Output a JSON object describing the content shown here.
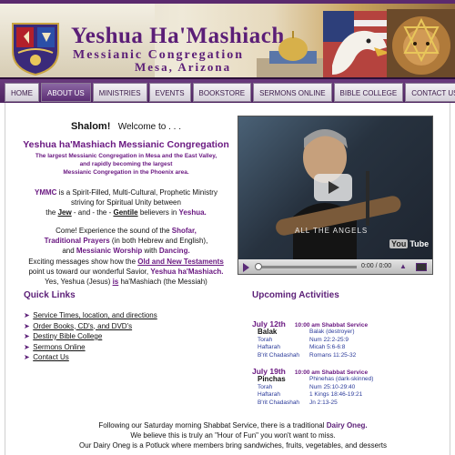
{
  "header": {
    "title_line1": "Yeshua Ha'Mashiach",
    "title_line2": "Messianic Congregation",
    "title_line3": "Mesa, Arizona"
  },
  "nav": {
    "items": [
      {
        "label": "HOME",
        "active": false
      },
      {
        "label": "ABOUT US",
        "active": true
      },
      {
        "label": "MINISTRIES",
        "active": false
      },
      {
        "label": "EVENTS",
        "active": false
      },
      {
        "label": "BOOKSTORE",
        "active": false
      },
      {
        "label": "SERMONS ONLINE",
        "active": false
      },
      {
        "label": "BIBLE COLLEGE",
        "active": false
      },
      {
        "label": "CONTACT US",
        "active": false
      }
    ]
  },
  "intro": {
    "shalom": "Shalom!",
    "welcome": "Welcome to . . .",
    "congregation": "Yeshua ha'Mashiach Messianic Congregation",
    "tagline1": "The largest Messianic Congregation in Mesa and the East Valley,",
    "tagline2": "and rapidly becoming the largest",
    "tagline3": "Messianic Congregation in the Phoenix area.",
    "ymmc_abbr": "YMMC",
    "ymmc_text1": " is a Spirit-Filled, Multi-Cultural, Prophetic Ministry",
    "ymmc_text2": "striving for Spiritual Unity between",
    "the1": "the ",
    "jew": "Jew",
    "and_the": " - and - the - ",
    "gentile": "Gentile",
    "believers_in": " believers in ",
    "yeshua": "Yeshua.",
    "come1": "Come!  Experience the sound of the ",
    "shofar": "Shofar,",
    "traditional_prayers": "Traditional Prayers",
    "come2": " (in both Hebrew and English),",
    "and1": "and ",
    "messianic_worship": "Messianic Worship",
    "with": " with ",
    "dancing": "Dancing.",
    "exciting": "Exciting messages show how the ",
    "old_new": "Old and New Testaments",
    "point_us": "point us toward our wonderful Savior, ",
    "yeshua_hamashiach": "Yeshua ha'Mashiach.",
    "yes_line1": "Yes, Yeshua (Jesus) ",
    "is": "is",
    "yes_line2": " ha'Mashiach (the Messiah)"
  },
  "video": {
    "caption": "ALL THE ANGELS",
    "time": "0:00 / 0:00",
    "logo_a": "You",
    "logo_b": "Tube"
  },
  "quick_links": {
    "title": "Quick Links",
    "items": [
      "Service Times, location, and directions",
      "Order Books, CD's, and DVD's",
      "Destiny Bible College",
      "Sermons Online",
      "Contact Us"
    ]
  },
  "activities": {
    "title": "Upcoming Activities",
    "events": [
      {
        "date": "July 12th",
        "time": "10:00 am Shabbat Service",
        "portion": "Balak",
        "portion_note": "Balak (destroyer)",
        "rows": [
          {
            "k": "Torah",
            "v": "Num 22:2-25:9"
          },
          {
            "k": "Haftarah",
            "v": "Micah 5:6-6:8"
          },
          {
            "k": "B'rit Chadashah",
            "v": "Romans 11:25-32"
          }
        ]
      },
      {
        "date": "July 19th",
        "time": "10:00 am  Shabbat Service",
        "portion": "Pinchas",
        "portion_note": "Phinehas (dark-skinned)",
        "rows": [
          {
            "k": "Torah",
            "v": "Num 25:10-29:40"
          },
          {
            "k": "Haftarah",
            "v": "1 Kings 18:46-19:21"
          },
          {
            "k": "B'rit Chadashah",
            "v": "Jn 2:13-25"
          }
        ]
      }
    ]
  },
  "footer": {
    "line1": "Following our Saturday morning Shabbat Service, there is a traditional ",
    "dairy_oneg": "Dairy Oneg.",
    "line2": "We believe this is truly an \"Hour of Fun\" you won't want to miss.",
    "line3": "Our Dairy Oneg is a Potluck where members bring sandwiches, fruits, vegetables, and desserts"
  }
}
